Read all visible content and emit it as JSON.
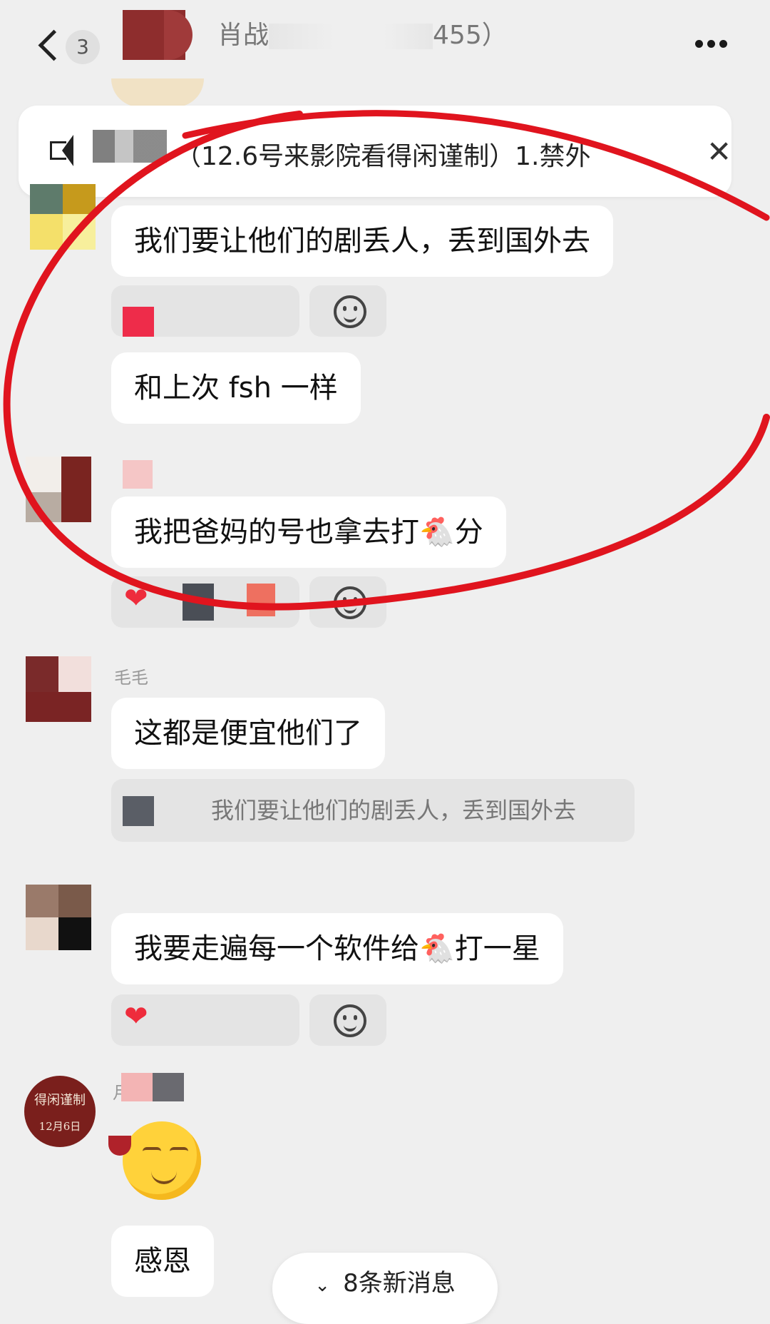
{
  "header": {
    "back_count": "3",
    "title_prefix": "肖战",
    "title_suffix": "455）"
  },
  "pinned": {
    "text": "（12.6号来影院看得闲谨制）1.禁外"
  },
  "messages": [
    {
      "text": "我们要让他们的剧丢人，丢到国外去"
    },
    {
      "text": "和上次 fsh 一样"
    },
    {
      "text": "我把爸妈的号也拿去打🐔分"
    },
    {
      "sender": "毛毛",
      "text": "这都是便宜他们了",
      "quote": "我们要让他们的剧丢人，丢到国外去"
    },
    {
      "text": "我要走遍每一个软件给🐔打一星"
    },
    {
      "sender": "月",
      "text": "感恩"
    }
  ],
  "new_messages_label": "8条新消息",
  "avatar_last": {
    "line1": "得闲谨制",
    "line2": "12月6日"
  },
  "colors": {
    "annotation_red": "#e0141e",
    "bubble": "#ffffff",
    "background": "#efefef"
  }
}
